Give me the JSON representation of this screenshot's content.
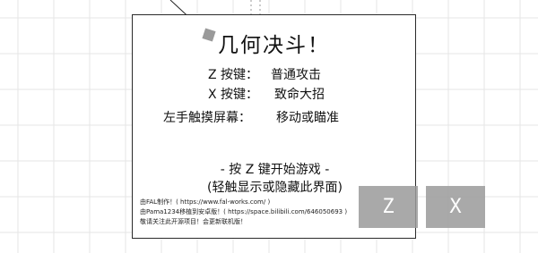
{
  "game": {
    "title": "几何决斗！",
    "controls": [
      {
        "key": "Z 按键：",
        "action": "普通攻击"
      },
      {
        "key": "X 按键：",
        "action": "致命大招"
      },
      {
        "key": "左手触摸屏幕：",
        "action": "移动或瞄准"
      }
    ],
    "start_prompt": "- 按 Z 键开始游戏 -",
    "toggle_hint": "(轻触显示或隐藏此界面)",
    "credits": [
      "由FAL制作！( https://www.fal-works.com/ )",
      "由Pama1234移植到安卓版！( https://space.bilibili.com/646050693 )",
      "敬请关注此开源项目！会更新联机版！"
    ]
  },
  "touch_buttons": {
    "z_label": "Z",
    "x_label": "X"
  },
  "colors": {
    "background": "#ffffff",
    "grid": "#e6e6e6",
    "panel_border": "#2a2a2a",
    "button": "#9b9b9b"
  }
}
